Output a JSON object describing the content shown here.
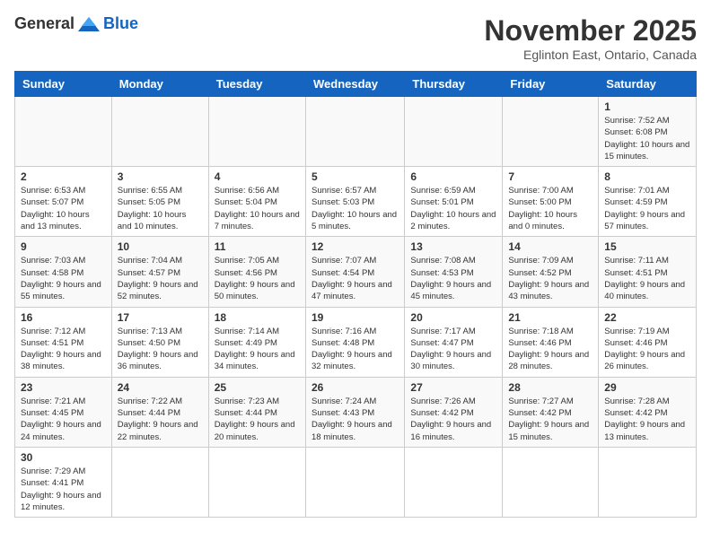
{
  "header": {
    "logo_general": "General",
    "logo_blue": "Blue",
    "month_title": "November 2025",
    "subtitle": "Eglinton East, Ontario, Canada"
  },
  "days_of_week": [
    "Sunday",
    "Monday",
    "Tuesday",
    "Wednesday",
    "Thursday",
    "Friday",
    "Saturday"
  ],
  "weeks": [
    [
      {
        "day": "",
        "info": ""
      },
      {
        "day": "",
        "info": ""
      },
      {
        "day": "",
        "info": ""
      },
      {
        "day": "",
        "info": ""
      },
      {
        "day": "",
        "info": ""
      },
      {
        "day": "",
        "info": ""
      },
      {
        "day": "1",
        "info": "Sunrise: 7:52 AM\nSunset: 6:08 PM\nDaylight: 10 hours and 15 minutes."
      }
    ],
    [
      {
        "day": "2",
        "info": "Sunrise: 6:53 AM\nSunset: 5:07 PM\nDaylight: 10 hours and 13 minutes."
      },
      {
        "day": "3",
        "info": "Sunrise: 6:55 AM\nSunset: 5:05 PM\nDaylight: 10 hours and 10 minutes."
      },
      {
        "day": "4",
        "info": "Sunrise: 6:56 AM\nSunset: 5:04 PM\nDaylight: 10 hours and 7 minutes."
      },
      {
        "day": "5",
        "info": "Sunrise: 6:57 AM\nSunset: 5:03 PM\nDaylight: 10 hours and 5 minutes."
      },
      {
        "day": "6",
        "info": "Sunrise: 6:59 AM\nSunset: 5:01 PM\nDaylight: 10 hours and 2 minutes."
      },
      {
        "day": "7",
        "info": "Sunrise: 7:00 AM\nSunset: 5:00 PM\nDaylight: 10 hours and 0 minutes."
      },
      {
        "day": "8",
        "info": "Sunrise: 7:01 AM\nSunset: 4:59 PM\nDaylight: 9 hours and 57 minutes."
      }
    ],
    [
      {
        "day": "9",
        "info": "Sunrise: 7:03 AM\nSunset: 4:58 PM\nDaylight: 9 hours and 55 minutes."
      },
      {
        "day": "10",
        "info": "Sunrise: 7:04 AM\nSunset: 4:57 PM\nDaylight: 9 hours and 52 minutes."
      },
      {
        "day": "11",
        "info": "Sunrise: 7:05 AM\nSunset: 4:56 PM\nDaylight: 9 hours and 50 minutes."
      },
      {
        "day": "12",
        "info": "Sunrise: 7:07 AM\nSunset: 4:54 PM\nDaylight: 9 hours and 47 minutes."
      },
      {
        "day": "13",
        "info": "Sunrise: 7:08 AM\nSunset: 4:53 PM\nDaylight: 9 hours and 45 minutes."
      },
      {
        "day": "14",
        "info": "Sunrise: 7:09 AM\nSunset: 4:52 PM\nDaylight: 9 hours and 43 minutes."
      },
      {
        "day": "15",
        "info": "Sunrise: 7:11 AM\nSunset: 4:51 PM\nDaylight: 9 hours and 40 minutes."
      }
    ],
    [
      {
        "day": "16",
        "info": "Sunrise: 7:12 AM\nSunset: 4:51 PM\nDaylight: 9 hours and 38 minutes."
      },
      {
        "day": "17",
        "info": "Sunrise: 7:13 AM\nSunset: 4:50 PM\nDaylight: 9 hours and 36 minutes."
      },
      {
        "day": "18",
        "info": "Sunrise: 7:14 AM\nSunset: 4:49 PM\nDaylight: 9 hours and 34 minutes."
      },
      {
        "day": "19",
        "info": "Sunrise: 7:16 AM\nSunset: 4:48 PM\nDaylight: 9 hours and 32 minutes."
      },
      {
        "day": "20",
        "info": "Sunrise: 7:17 AM\nSunset: 4:47 PM\nDaylight: 9 hours and 30 minutes."
      },
      {
        "day": "21",
        "info": "Sunrise: 7:18 AM\nSunset: 4:46 PM\nDaylight: 9 hours and 28 minutes."
      },
      {
        "day": "22",
        "info": "Sunrise: 7:19 AM\nSunset: 4:46 PM\nDaylight: 9 hours and 26 minutes."
      }
    ],
    [
      {
        "day": "23",
        "info": "Sunrise: 7:21 AM\nSunset: 4:45 PM\nDaylight: 9 hours and 24 minutes."
      },
      {
        "day": "24",
        "info": "Sunrise: 7:22 AM\nSunset: 4:44 PM\nDaylight: 9 hours and 22 minutes."
      },
      {
        "day": "25",
        "info": "Sunrise: 7:23 AM\nSunset: 4:44 PM\nDaylight: 9 hours and 20 minutes."
      },
      {
        "day": "26",
        "info": "Sunrise: 7:24 AM\nSunset: 4:43 PM\nDaylight: 9 hours and 18 minutes."
      },
      {
        "day": "27",
        "info": "Sunrise: 7:26 AM\nSunset: 4:42 PM\nDaylight: 9 hours and 16 minutes."
      },
      {
        "day": "28",
        "info": "Sunrise: 7:27 AM\nSunset: 4:42 PM\nDaylight: 9 hours and 15 minutes."
      },
      {
        "day": "29",
        "info": "Sunrise: 7:28 AM\nSunset: 4:42 PM\nDaylight: 9 hours and 13 minutes."
      }
    ],
    [
      {
        "day": "30",
        "info": "Sunrise: 7:29 AM\nSunset: 4:41 PM\nDaylight: 9 hours and 12 minutes."
      },
      {
        "day": "",
        "info": ""
      },
      {
        "day": "",
        "info": ""
      },
      {
        "day": "",
        "info": ""
      },
      {
        "day": "",
        "info": ""
      },
      {
        "day": "",
        "info": ""
      },
      {
        "day": "",
        "info": ""
      }
    ]
  ]
}
